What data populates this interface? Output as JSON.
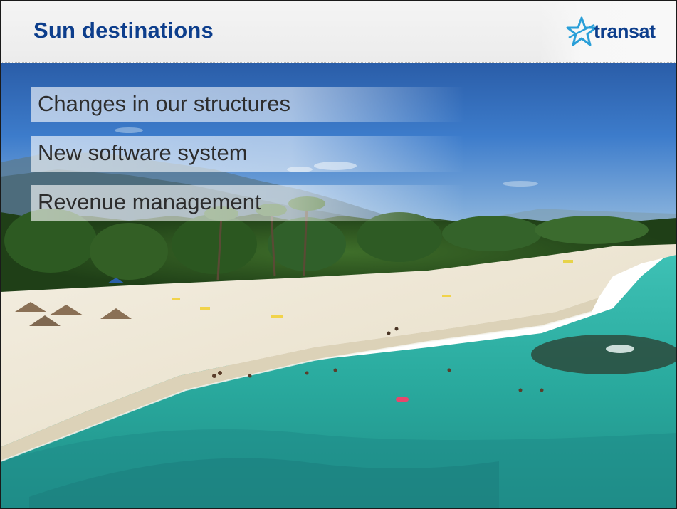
{
  "slide": {
    "title": "Sun destinations",
    "logo": {
      "text": "transat",
      "icon": "star-icon",
      "color": "#0d3e8c",
      "star_color": "#2a9fd8"
    },
    "bullets": [
      {
        "label": "Changes in our structures"
      },
      {
        "label": "New software system"
      },
      {
        "label": "Revenue management"
      }
    ],
    "background_image": "beach-photo"
  },
  "colors": {
    "title": "#0d3e8c",
    "header_bg": "#ededed",
    "sea": "#2fb2a6",
    "sky": "#3c78c4",
    "sand": "#efe9da"
  }
}
